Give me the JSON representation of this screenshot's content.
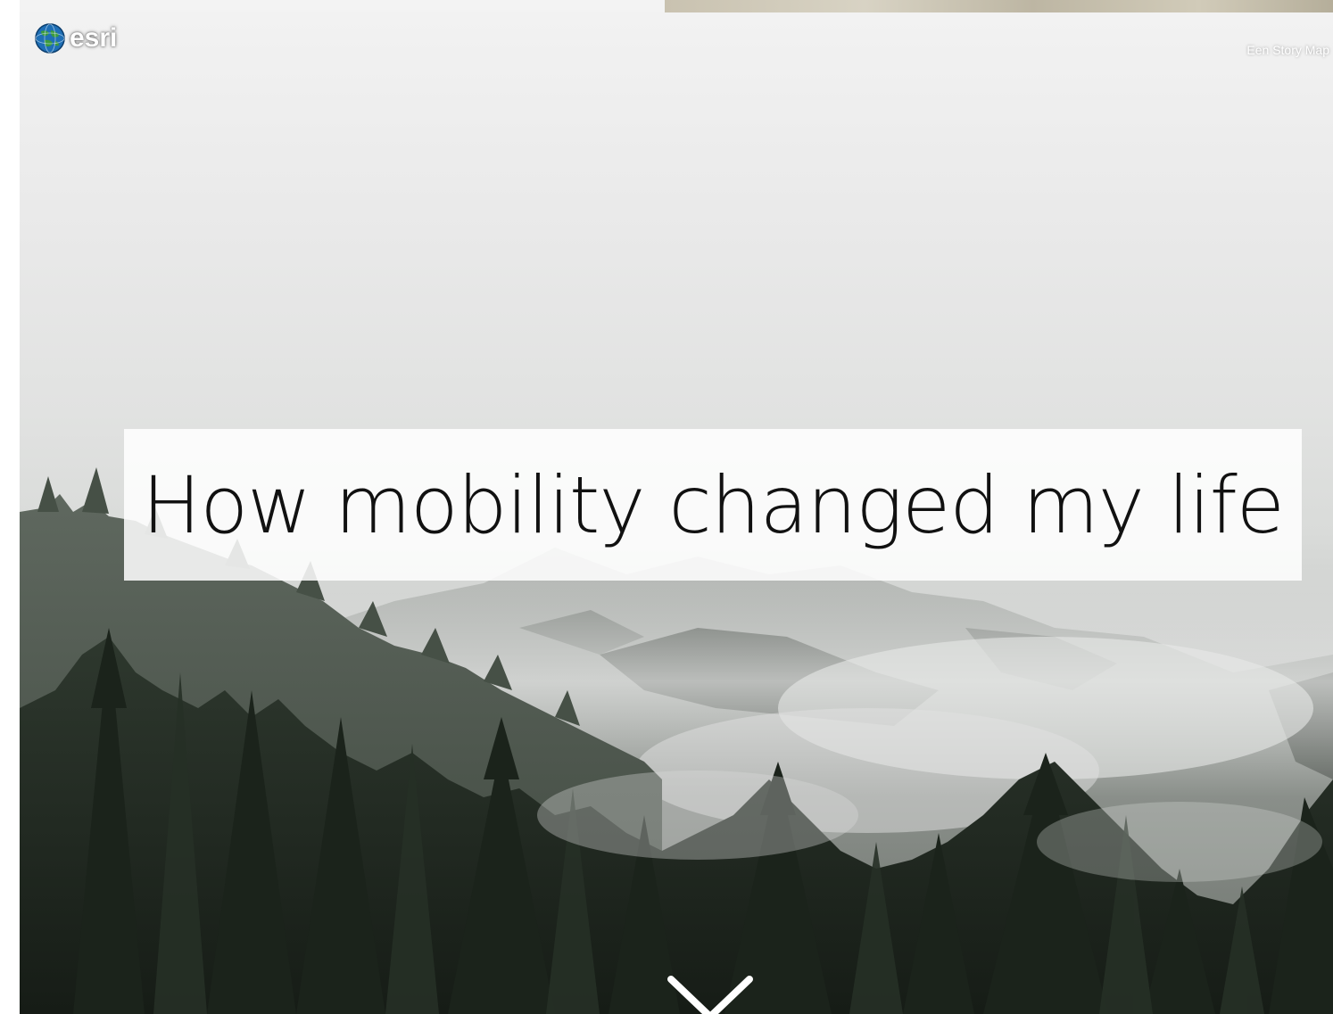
{
  "header": {
    "logo_icon": "globe-icon",
    "logo_text": "esri",
    "story_link_label": "Een Story Map"
  },
  "hero": {
    "title": "How mobility changed my life",
    "scroll_icon": "chevron-down-icon"
  },
  "colors": {
    "title_text": "#111111",
    "title_box": "#ffffff",
    "forest_dark": "#1f2a1f",
    "mist": "#e6e6e6"
  }
}
